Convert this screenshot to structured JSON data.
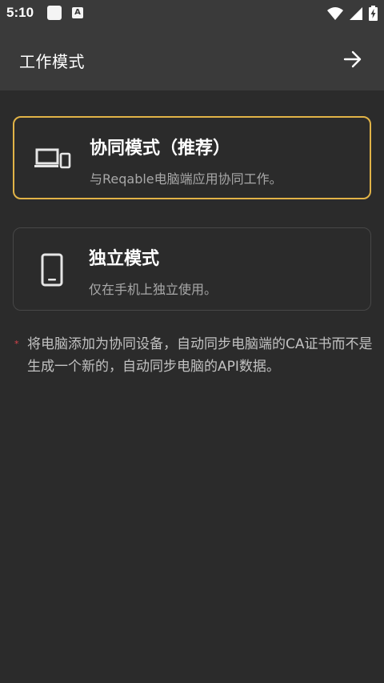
{
  "status_bar": {
    "time": "5:10",
    "notif_icon_letter": "A",
    "icons": [
      "square-notification-icon",
      "app-notification-icon",
      "wifi-icon",
      "cellular-icon",
      "battery-charging-icon"
    ]
  },
  "app_bar": {
    "title": "工作模式",
    "next_icon": "arrow-right-icon"
  },
  "modes": [
    {
      "title": "协同模式（推荐）",
      "description": "与Reqable电脑端应用协同工作。",
      "icon": "devices-icon",
      "selected": true
    },
    {
      "title": "独立模式",
      "description": "仅在手机上独立使用。",
      "icon": "phone-icon",
      "selected": false
    }
  ],
  "note": {
    "marker": "*",
    "text": "将电脑添加为协同设备，自动同步电脑端的CA证书而不是生成一个新的，自动同步电脑的API数据。"
  },
  "colors": {
    "background": "#2b2b2b",
    "bar": "#3a3a3a",
    "accent": "#e1b347",
    "required_marker": "#d9424a"
  }
}
